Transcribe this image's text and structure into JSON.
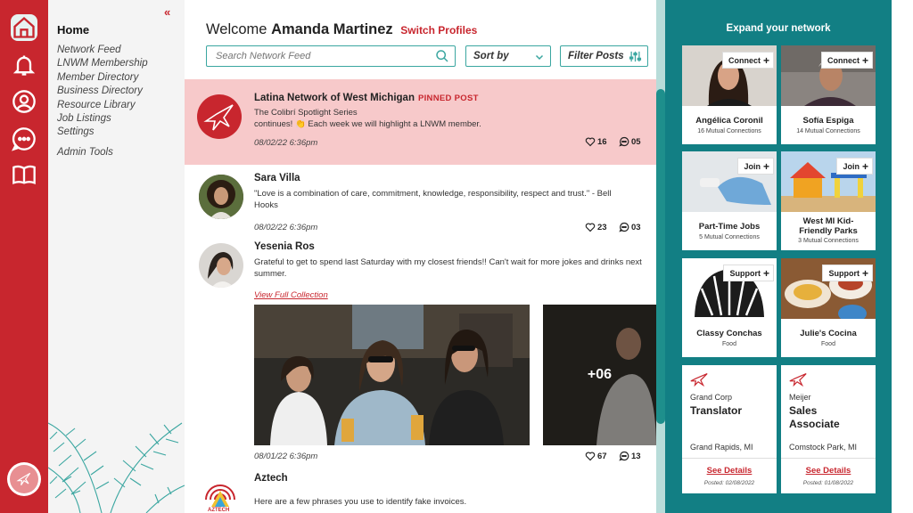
{
  "menu": {
    "title": "Home",
    "collapse_icon": "«",
    "items": [
      "Network Feed",
      "LNWM Membership",
      "Member Directory",
      "Business Directory",
      "Resource Library",
      "Job Listings",
      "Settings"
    ],
    "admin": "Admin Tools"
  },
  "header": {
    "welcome": "Welcome",
    "user_name": "Amanda Martinez",
    "switch_profiles": "Switch Profiles",
    "search_placeholder": "Search Network Feed",
    "sort_label": "Sort by",
    "filter_label": "Filter Posts"
  },
  "feed": {
    "pinned": {
      "author": "Latina Network of West Michigan",
      "tag": "PINNED POST",
      "line1": "The Colibrí Spotlight Series",
      "line2": "continues! 👏 Each week we will highlight a LNWM member.",
      "date": "08/02/22 6:36pm",
      "likes": "16",
      "comments": "05"
    },
    "sara": {
      "author": "Sara Villa",
      "text": "\"Love is a combination of care, commitment, knowledge, responsibility, respect and trust.\" - Bell Hooks",
      "date": "08/02/22 6:36pm",
      "likes": "23",
      "comments": "03"
    },
    "yesenia": {
      "author": "Yesenia Ros",
      "text": "Grateful to get to spend last Saturday with my closest friends!! Can't wait for more jokes and drinks next summer.",
      "view_collection": "View Full Collection",
      "more_photos": "+06",
      "date": "08/01/22 6:36pm",
      "likes": "67",
      "comments": "13"
    },
    "aztech": {
      "author": "Aztech",
      "logo_text": "AZTECH",
      "text": "Here are a few phrases you use to identify fake invoices."
    }
  },
  "network": {
    "title": "Expand your network",
    "cards": [
      {
        "name": "Angélica Coronil",
        "sub": "16 Mutual Connections",
        "button": "Connect"
      },
      {
        "name": "Sofía Espiga",
        "sub": "14 Mutual Connections",
        "button": "Connect"
      },
      {
        "name": "Part-Time Jobs",
        "sub": "5 Mutual Connections",
        "button": "Join"
      },
      {
        "name": "West MI Kid-Friendly Parks",
        "sub": "3 Mutual Connections",
        "button": "Join"
      },
      {
        "name": "Classy Conchas",
        "sub": "Food",
        "button": "Support"
      },
      {
        "name": "Julie's Cocina",
        "sub": "Food",
        "button": "Support"
      }
    ],
    "jobs": [
      {
        "company": "Grand Corp",
        "title": "Translator",
        "location": "Grand Rapids, MI",
        "link": "See Details",
        "posted": "Posted: 02/08/2022"
      },
      {
        "company": "Meijer",
        "title": "Sales Associate",
        "location": "Comstock Park, MI",
        "link": "See Details",
        "posted": "Posted: 01/08/2022"
      }
    ]
  },
  "colors": {
    "brand_red": "#c8262e",
    "teal": "#127f84",
    "pinned_bg": "#f7c9ca"
  }
}
